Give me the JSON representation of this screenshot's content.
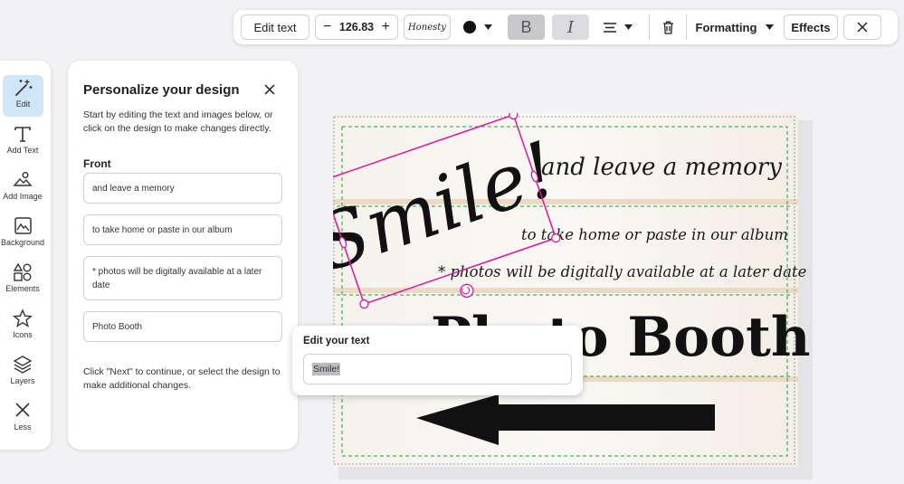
{
  "toolbar": {
    "edit_text_label": "Edit text",
    "font_size_value": "126.83",
    "font_name": "Honesty",
    "text_color": "#111111",
    "bold_label": "B",
    "italic_label": "I",
    "formatting_label": "Formatting",
    "effects_label": "Effects"
  },
  "sidebar": {
    "items": [
      {
        "label": "Edit",
        "icon": "magic-wand-icon",
        "active": true
      },
      {
        "label": "Add Text",
        "icon": "text-icon"
      },
      {
        "label": "Add Image",
        "icon": "image-add-icon"
      },
      {
        "label": "Background",
        "icon": "background-icon"
      },
      {
        "label": "Elements",
        "icon": "shapes-icon"
      },
      {
        "label": "Icons",
        "icon": "star-icon"
      },
      {
        "label": "Layers",
        "icon": "layers-icon"
      },
      {
        "label": "Less",
        "icon": "close-icon"
      }
    ]
  },
  "panel": {
    "title": "Personalize your design",
    "intro": "Start by editing the text and images below, or click on the design to make changes directly.",
    "section": "Front",
    "fields": [
      "and leave a memory",
      "to take home or paste in our album",
      "* photos will be digitally available at a later date",
      "Photo Booth"
    ],
    "footer": "Click \"Next\" to continue, or select the design to make additional changes."
  },
  "design": {
    "smile_text": "Smile!",
    "line1": "and leave a memory",
    "line2": "to take home or paste in our album",
    "line3": "* photos will be digitally available at a later date",
    "photo_booth": "Photo Booth",
    "selection_color": "#e0139c",
    "guide_color": "#1aa33a"
  },
  "popover": {
    "label": "Edit your text",
    "value": "Smile!"
  }
}
